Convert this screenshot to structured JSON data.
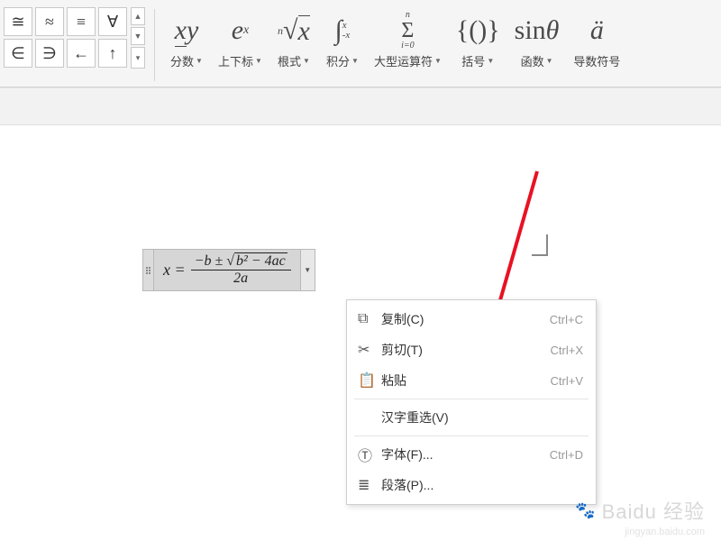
{
  "symbols": [
    "≅",
    "≈",
    "≡",
    "∀",
    "∈",
    "∋",
    "←",
    "↑"
  ],
  "ribbon": [
    {
      "icon": "x⁄y",
      "label": "分数"
    },
    {
      "icon": "eˣ",
      "label": "上下标"
    },
    {
      "icon": "ⁿ√x",
      "label": "根式"
    },
    {
      "icon": "∫⁻ₓˣ",
      "label": "积分"
    },
    {
      "icon": "Σ",
      "label": "大型运算符"
    },
    {
      "icon": "{()}",
      "label": "括号"
    },
    {
      "icon": "sinθ",
      "label": "函数"
    },
    {
      "icon": "ä",
      "label": "导数符号"
    }
  ],
  "equation": {
    "lhs": "x =",
    "num": "−b ± ",
    "sqrt_inner": "b² − 4ac",
    "den": "2a"
  },
  "context_menu": [
    {
      "icon": "⧉",
      "label": "复制(C)",
      "shortcut": "Ctrl+C"
    },
    {
      "icon": "✂",
      "label": "剪切(T)",
      "shortcut": "Ctrl+X"
    },
    {
      "icon": "📋",
      "label": "粘贴",
      "shortcut": "Ctrl+V"
    },
    {
      "sep": true
    },
    {
      "icon": "",
      "label": "汉字重选(V)",
      "shortcut": ""
    },
    {
      "sep": true
    },
    {
      "icon": "Ⓣ",
      "label": "字体(F)...",
      "shortcut": "Ctrl+D"
    },
    {
      "icon": "≣",
      "label": "段落(P)...",
      "shortcut": ""
    }
  ],
  "watermark": {
    "main": "Baidu 经验",
    "sub": "jingyan.baidu.com"
  }
}
